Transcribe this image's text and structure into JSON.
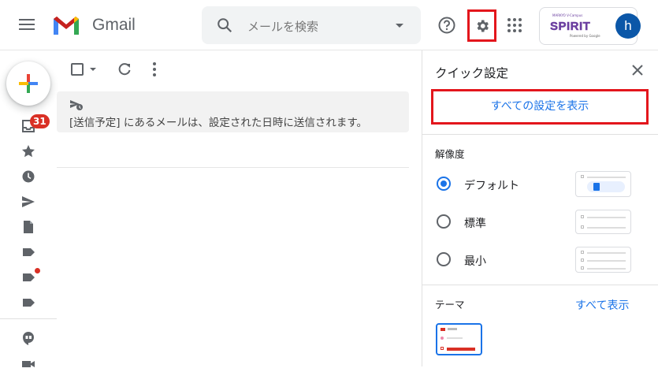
{
  "app": {
    "name": "Gmail"
  },
  "search": {
    "placeholder": "メールを検索"
  },
  "account": {
    "org_top": "MARKYO V-Campus",
    "org_name": "SPIRIT",
    "org_bottom": "Powered by Google",
    "avatar_initial": "h"
  },
  "rail": {
    "inbox_badge": "31"
  },
  "toolbar": {},
  "notice": {
    "text": "[送信予定] にあるメールは、設定された日時に送信されます。"
  },
  "quick_settings": {
    "title": "クイック設定",
    "all_settings_label": "すべての設定を表示",
    "density": {
      "label": "解像度",
      "options": [
        {
          "label": "デフォルト",
          "selected": true
        },
        {
          "label": "標準",
          "selected": false
        },
        {
          "label": "最小",
          "selected": false
        }
      ]
    },
    "theme": {
      "label": "テーマ",
      "view_all_label": "すべて表示"
    }
  },
  "colors": {
    "accent": "#1a73e8",
    "highlight_box": "#e3161c",
    "badge": "#d93025"
  }
}
